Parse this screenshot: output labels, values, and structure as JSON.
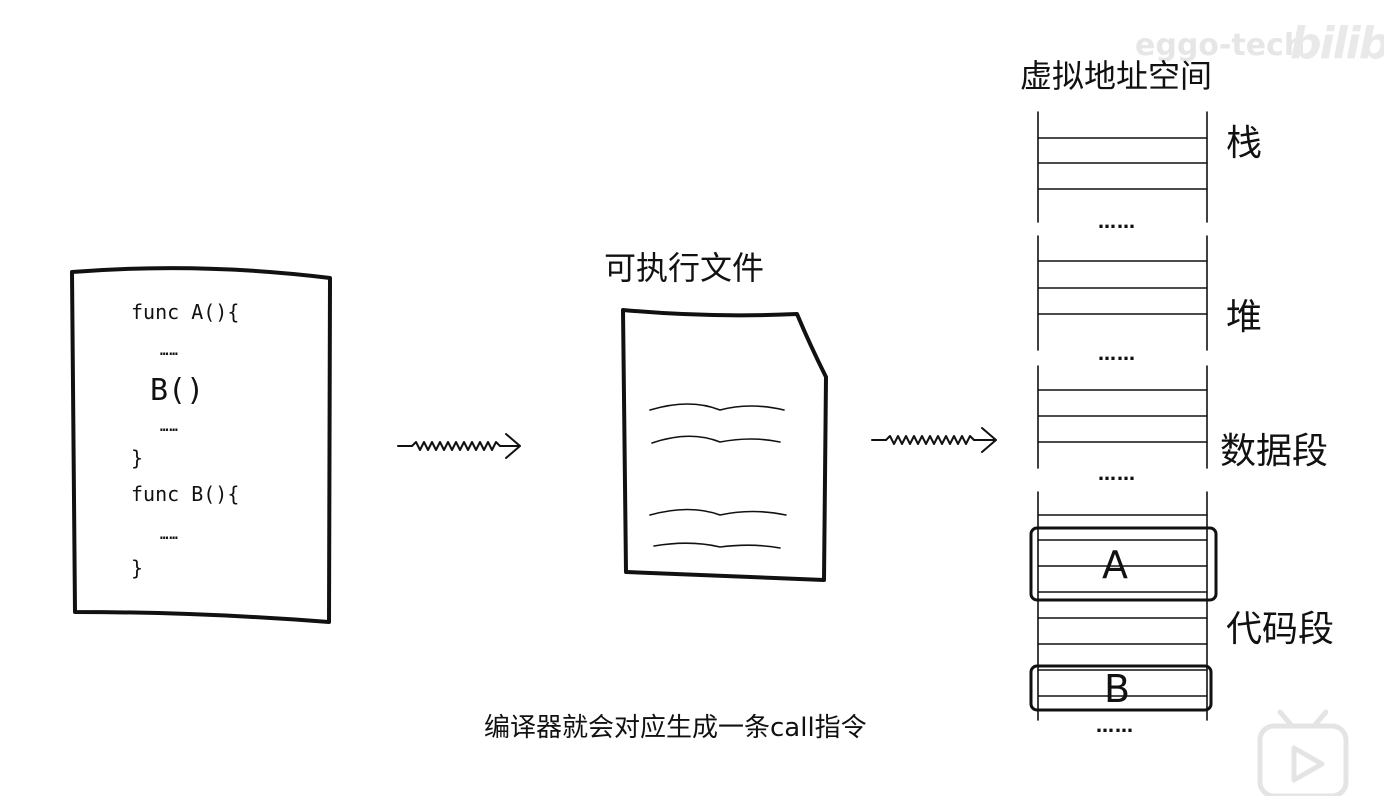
{
  "watermark": {
    "text": "eggo-tech",
    "logo": "bilibili"
  },
  "source_code": {
    "lines": [
      "func A(){",
      "……",
      "B()",
      "……",
      "}",
      "func B(){",
      "……",
      "}"
    ]
  },
  "executable": {
    "title": "可执行文件"
  },
  "memory": {
    "title": "虚拟地址空间",
    "segments": [
      "栈",
      "堆",
      "数据段",
      "代码段"
    ],
    "ellipsis": "……",
    "block_a": "A",
    "block_b": "B"
  },
  "subtitle": "编译器就会对应生成一条call指令",
  "player": {
    "play_icon": "play-icon"
  }
}
